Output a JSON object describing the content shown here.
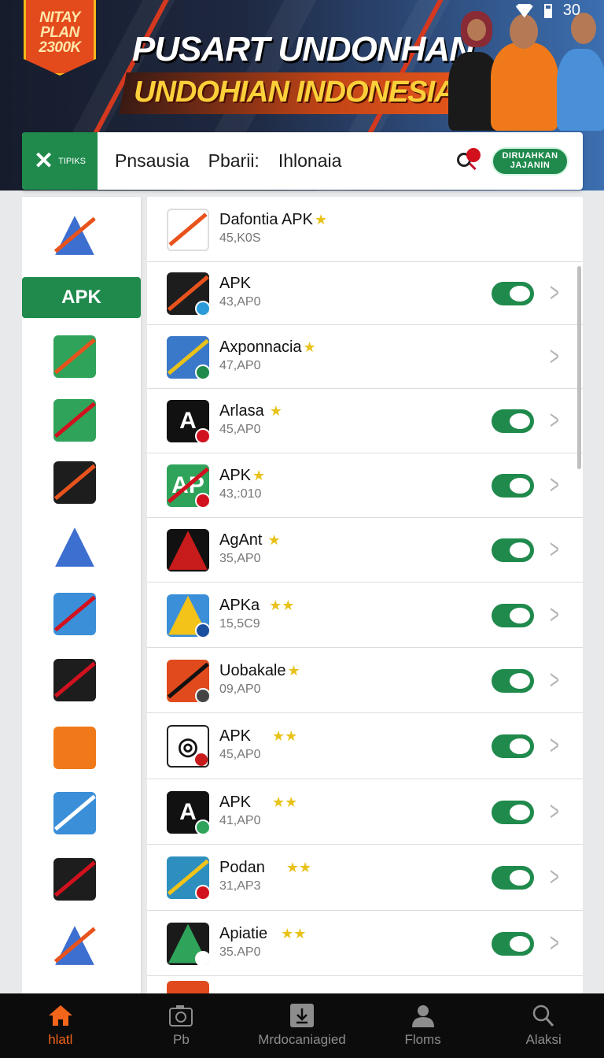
{
  "status_bar": {
    "time": "30"
  },
  "banner": {
    "badge_lines": [
      "NITAY",
      "PLAN",
      "2300K"
    ],
    "title_line1": "PUSART UNDONHAN",
    "title_line2": "UNDOHIAN INDONESIA"
  },
  "topbar": {
    "logo_text": "TIPIKS",
    "crumbs": [
      "Pnsausia",
      "Pbarii:",
      "Ihlonaia"
    ],
    "join_button": "DIRUAHKAN\nJAJANIN"
  },
  "sidebar": {
    "active_label": "APK"
  },
  "apps": [
    {
      "name": "Dafontia APK",
      "stars": "★",
      "size": "45,K0S",
      "toggle": false,
      "chevron": false
    },
    {
      "name": "APK",
      "stars": "",
      "size": "43,AP0",
      "toggle": true,
      "chevron": true
    },
    {
      "name": "Axponnacia",
      "stars": "★",
      "size": "47,AP0",
      "toggle": false,
      "chevron": true
    },
    {
      "name": "Arlasa",
      "stars": " ★",
      "size": "45,AP0",
      "toggle": true,
      "chevron": true
    },
    {
      "name": "APK",
      "stars": "★",
      "size": "43,:010",
      "toggle": true,
      "chevron": true
    },
    {
      "name": "AgAnt",
      "stars": " ★",
      "size": "35,AP0",
      "toggle": true,
      "chevron": true
    },
    {
      "name": "APKa",
      "stars": "  ★★",
      "size": "15,5C9",
      "toggle": true,
      "chevron": true
    },
    {
      "name": "Uobakale",
      "stars": "★",
      "size": "09,AP0",
      "toggle": true,
      "chevron": true
    },
    {
      "name": "APK",
      "stars": "     ★★",
      "size": "45,AP0",
      "toggle": true,
      "chevron": true
    },
    {
      "name": "APK",
      "stars": "     ★★",
      "size": "41,AP0",
      "toggle": true,
      "chevron": true
    },
    {
      "name": "Podan",
      "stars": "     ★★",
      "size": "31,AP3",
      "toggle": true,
      "chevron": true
    },
    {
      "name": "Apiatie",
      "stars": "   ★★",
      "size": "35.AP0",
      "toggle": true,
      "chevron": true
    }
  ],
  "nav": [
    {
      "label": "hlatl",
      "icon": "home-icon",
      "active": true
    },
    {
      "label": "Pb",
      "icon": "camera-icon",
      "active": false
    },
    {
      "label": "Mrdocaniagied",
      "icon": "download-icon",
      "active": false
    },
    {
      "label": "Floms",
      "icon": "profile-icon",
      "active": false
    },
    {
      "label": "Alaksi",
      "icon": "search-icon",
      "active": false
    }
  ],
  "colors": {
    "accent": "#1f8a4c",
    "nav_active": "#f2651a",
    "banner_text": "#fbd03a"
  }
}
